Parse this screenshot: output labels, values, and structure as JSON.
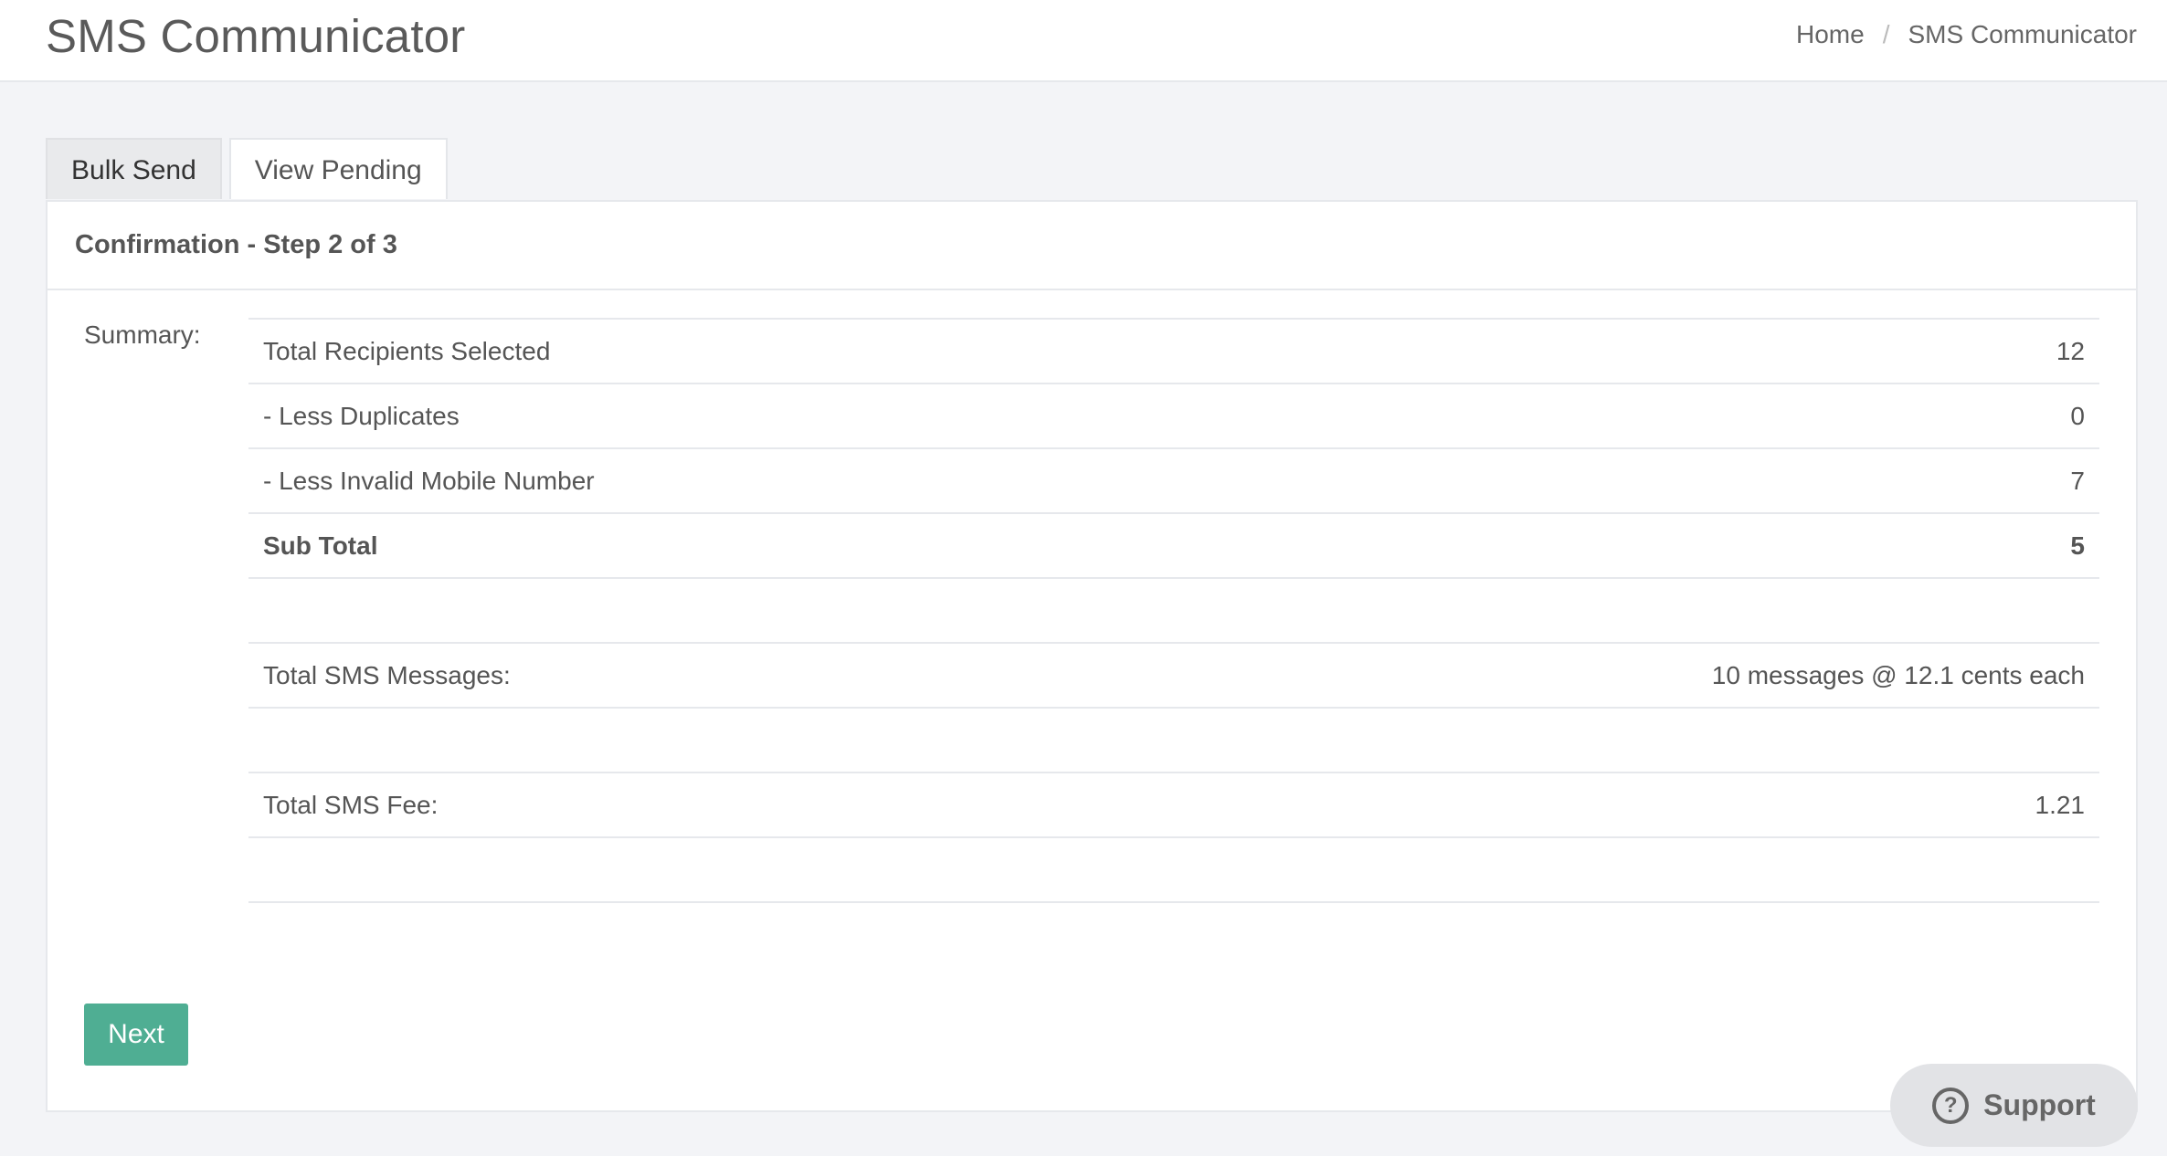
{
  "header": {
    "title": "SMS Communicator",
    "breadcrumb": [
      "Home",
      "SMS Communicator"
    ],
    "breadcrumb_separator": "/"
  },
  "tabs": [
    {
      "label": "Bulk Send",
      "active": true
    },
    {
      "label": "View Pending",
      "active": false
    }
  ],
  "panel": {
    "heading": "Confirmation - Step 2 of 3",
    "summary_label": "Summary:",
    "rows": [
      {
        "label": "Total Recipients Selected",
        "value": "12"
      },
      {
        "label": "- Less Duplicates",
        "value": "0"
      },
      {
        "label": "- Less Invalid Mobile Number",
        "value": "7"
      },
      {
        "label": "Sub Total",
        "value": "5"
      },
      {
        "label": "",
        "value": ""
      },
      {
        "label": "Total SMS Messages:",
        "value": "10 messages @ 12.1 cents each"
      },
      {
        "label": "",
        "value": ""
      },
      {
        "label": "Total SMS Fee:",
        "value": "1.21"
      },
      {
        "label": "",
        "value": ""
      }
    ],
    "next_label": "Next"
  },
  "support": {
    "label": "Support",
    "icon": "question-circle-icon"
  },
  "colors": {
    "accent": "#4fae93",
    "background": "#f3f4f7"
  }
}
